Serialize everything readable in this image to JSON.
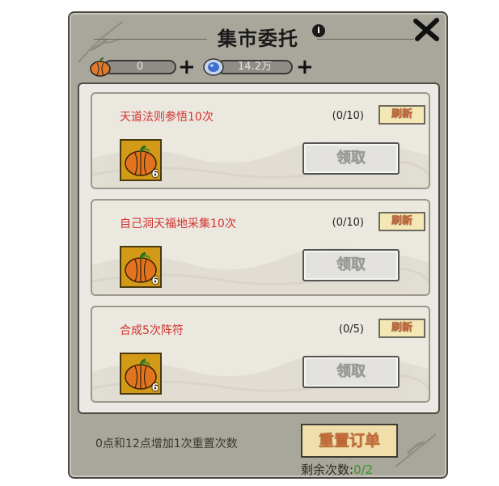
{
  "header": {
    "title": "集市委托",
    "info_icon": "info-icon",
    "close_icon": "close-icon"
  },
  "resources": [
    {
      "icon": "pumpkin-icon",
      "value": "0"
    },
    {
      "icon": "spirit-stone-icon",
      "value": "14.2万"
    }
  ],
  "tasks": [
    {
      "title": "天道法则参悟10次",
      "progress": "(0/10)",
      "refresh_label": "刷新",
      "reward_icon": "pumpkin-icon",
      "reward_count": "6",
      "claim_label": "领取"
    },
    {
      "title": "自己洞天福地采集10次",
      "progress": "(0/10)",
      "refresh_label": "刷新",
      "reward_icon": "pumpkin-icon",
      "reward_count": "6",
      "claim_label": "领取"
    },
    {
      "title": "合成5次阵符",
      "progress": "(0/5)",
      "refresh_label": "刷新",
      "reward_icon": "pumpkin-icon",
      "reward_count": "6",
      "claim_label": "领取"
    }
  ],
  "footer": {
    "note": "0点和12点增加1次重置次数",
    "reset_label": "重置订单",
    "remaining_label": "剩余次数:",
    "remaining_count": "0/2"
  },
  "colors": {
    "task_title": "#d2322d",
    "remaining_count": "#3a9a2a",
    "reward_bg": "#d39a18"
  }
}
